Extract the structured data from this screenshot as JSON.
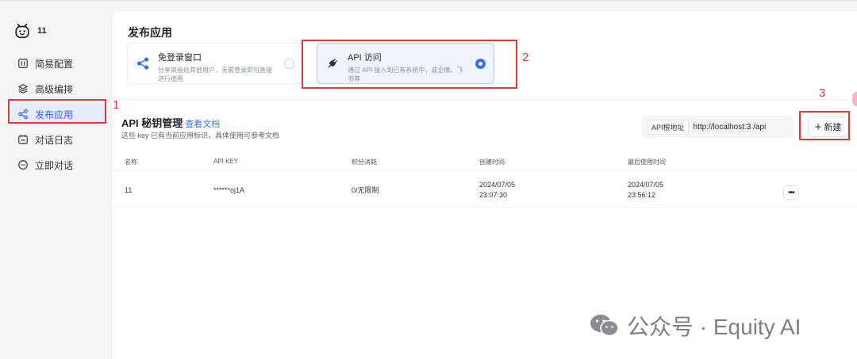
{
  "sidebar": {
    "app_name": "11",
    "items": [
      {
        "label": "简易配置",
        "icon": "panel-icon"
      },
      {
        "label": "高级编排",
        "icon": "layers-icon"
      },
      {
        "label": "发布应用",
        "icon": "share-icon"
      },
      {
        "label": "对话日志",
        "icon": "calendar-icon"
      },
      {
        "label": "立即对话",
        "icon": "chat-icon"
      }
    ]
  },
  "publish": {
    "title": "发布应用",
    "options": [
      {
        "title": "免登录窗口",
        "desc_line1": "分享链接给其他用户，无需登录即可直接",
        "desc_line2": "进行使用",
        "selected": false
      },
      {
        "title": "API 访问",
        "desc_line1": "通过 API 接入到已有系统中，或企微、飞",
        "desc_line2": "书等",
        "selected": true
      }
    ]
  },
  "api_keys": {
    "title": "API 秘钥管理",
    "doc_link": "查看文档",
    "subtitle": "这些 key 已有当前应用标识，具体使用可参考文档",
    "base_url_label": "API根地址",
    "base_url": "http://localhost:3      /api",
    "new_button": "新建",
    "columns": [
      "名称",
      "API KEY",
      "积分消耗",
      "创建时间",
      "最后使用时间"
    ],
    "rows": [
      {
        "name": "11",
        "key": "******oj1A",
        "usage": "0/无限制",
        "created_date": "2024/07/05",
        "created_time": "23:07:30",
        "last_date": "2024/07/05",
        "last_time": "23:56:12"
      }
    ]
  },
  "annotations": [
    "1",
    "2",
    "3"
  ],
  "watermark": "公众号 · Equity AI",
  "colors": {
    "accent": "#3370ff",
    "annotation": "#e53935"
  }
}
